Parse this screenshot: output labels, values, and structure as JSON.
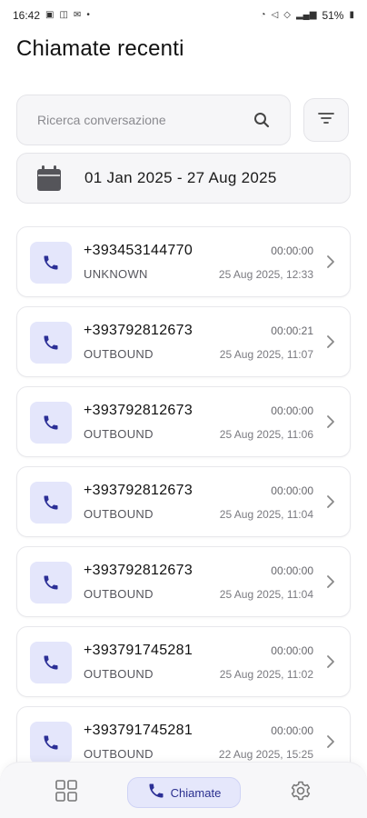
{
  "status_bar": {
    "time": "16:42",
    "battery": "51%"
  },
  "page": {
    "title": "Chiamate recenti"
  },
  "search": {
    "placeholder": "Ricerca conversazione",
    "value": ""
  },
  "date_range": {
    "text": "01 Jan 2025 - 27 Aug 2025"
  },
  "calls": [
    {
      "number": "+393453144770",
      "direction": "UNKNOWN",
      "duration": "00:00:00",
      "datetime": "25 Aug 2025, 12:33"
    },
    {
      "number": "+393792812673",
      "direction": "OUTBOUND",
      "duration": "00:00:21",
      "datetime": "25 Aug 2025, 11:07"
    },
    {
      "number": "+393792812673",
      "direction": "OUTBOUND",
      "duration": "00:00:00",
      "datetime": "25 Aug 2025, 11:06"
    },
    {
      "number": "+393792812673",
      "direction": "OUTBOUND",
      "duration": "00:00:00",
      "datetime": "25 Aug 2025, 11:04"
    },
    {
      "number": "+393792812673",
      "direction": "OUTBOUND",
      "duration": "00:00:00",
      "datetime": "25 Aug 2025, 11:04"
    },
    {
      "number": "+393791745281",
      "direction": "OUTBOUND",
      "duration": "00:00:00",
      "datetime": "25 Aug 2025, 11:02"
    },
    {
      "number": "+393791745281",
      "direction": "OUTBOUND",
      "duration": "00:00:00",
      "datetime": "22 Aug 2025, 15:25"
    }
  ],
  "bottom_nav": {
    "active_label": "Chiamate",
    "items": [
      {
        "icon": "dashboard-grid-icon"
      },
      {
        "icon": "phone-icon",
        "label": "Chiamate"
      },
      {
        "icon": "gear-icon"
      }
    ]
  },
  "colors": {
    "accent": "#2b2f96",
    "accent_bg": "#e4e6fb",
    "surface": "#f6f6f8",
    "border": "#e4e4e8"
  }
}
